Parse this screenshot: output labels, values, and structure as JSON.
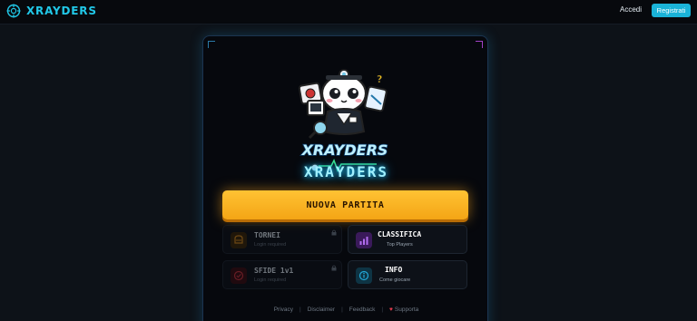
{
  "topbar": {
    "brand": "XRAYDERS",
    "login_label": "Accedi",
    "register_label": "Registrati"
  },
  "card": {
    "logo_text": "XRAYDERS",
    "title": "XRAYDERS",
    "new_game_label": "NUOVA PARTITA",
    "tiles": [
      {
        "title": "TORNEI",
        "subtitle": "Login required",
        "locked": true,
        "icon": "trophy-icon"
      },
      {
        "title": "CLASSIFICA",
        "subtitle": "Top Players",
        "locked": false,
        "icon": "bar-chart-icon"
      },
      {
        "title": "SFIDE 1v1",
        "subtitle": "Login required",
        "locked": true,
        "icon": "target-icon"
      },
      {
        "title": "INFO",
        "subtitle": "Come giocare",
        "locked": false,
        "icon": "info-icon"
      }
    ],
    "footer": {
      "privacy": "Privacy",
      "disclaimer": "Disclaimer",
      "feedback": "Feedback",
      "support": "Supporta",
      "separator": "|"
    }
  },
  "colors": {
    "accent": "#1ab3d8",
    "brand": "#21c8e8",
    "button": "#f4a515",
    "locked_orange": "#d68a1c",
    "locked_red": "#c8323c",
    "purple": "#8a3fd0",
    "teal": "#22a8d8"
  }
}
